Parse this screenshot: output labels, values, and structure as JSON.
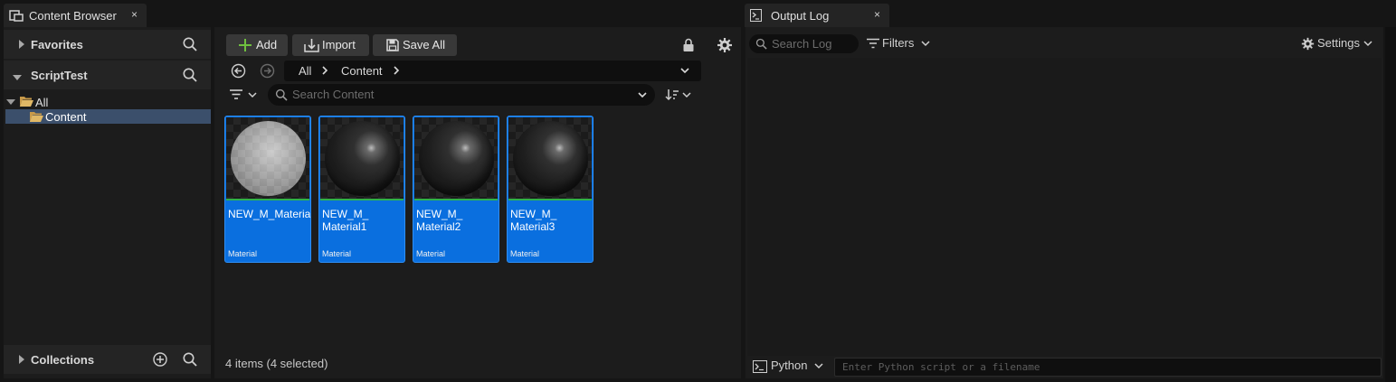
{
  "tabs": {
    "content_browser": "Content Browser",
    "output_log": "Output Log",
    "close_glyph": "×"
  },
  "left": {
    "favorites": "Favorites",
    "project": "ScriptTest",
    "tree": [
      {
        "label": "All"
      },
      {
        "label": "Content",
        "selected": true
      }
    ],
    "collections": "Collections"
  },
  "toolbar": {
    "add": "Add",
    "import": "Import",
    "save_all": "Save All"
  },
  "breadcrumb": [
    "All",
    "Content"
  ],
  "search": {
    "placeholder": "Search Content"
  },
  "assets": [
    {
      "name": "NEW_M_Material",
      "type": "Material",
      "thumb": "light"
    },
    {
      "name": "NEW_M_\nMaterial1",
      "type": "Material",
      "thumb": "dark"
    },
    {
      "name": "NEW_M_\nMaterial2",
      "type": "Material",
      "thumb": "dark"
    },
    {
      "name": "NEW_M_\nMaterial3",
      "type": "Material",
      "thumb": "dark"
    }
  ],
  "status": "4 items (4 selected)",
  "log": {
    "search_placeholder": "Search Log",
    "filters": "Filters",
    "settings": "Settings",
    "python": "Python",
    "python_placeholder": "Enter Python script or a filename"
  },
  "colors": {
    "selection": "#0a6fdf",
    "add_plus": "#6fbf3f",
    "thumb_underline": "#2fb24a",
    "folder": "#c89a4a"
  }
}
